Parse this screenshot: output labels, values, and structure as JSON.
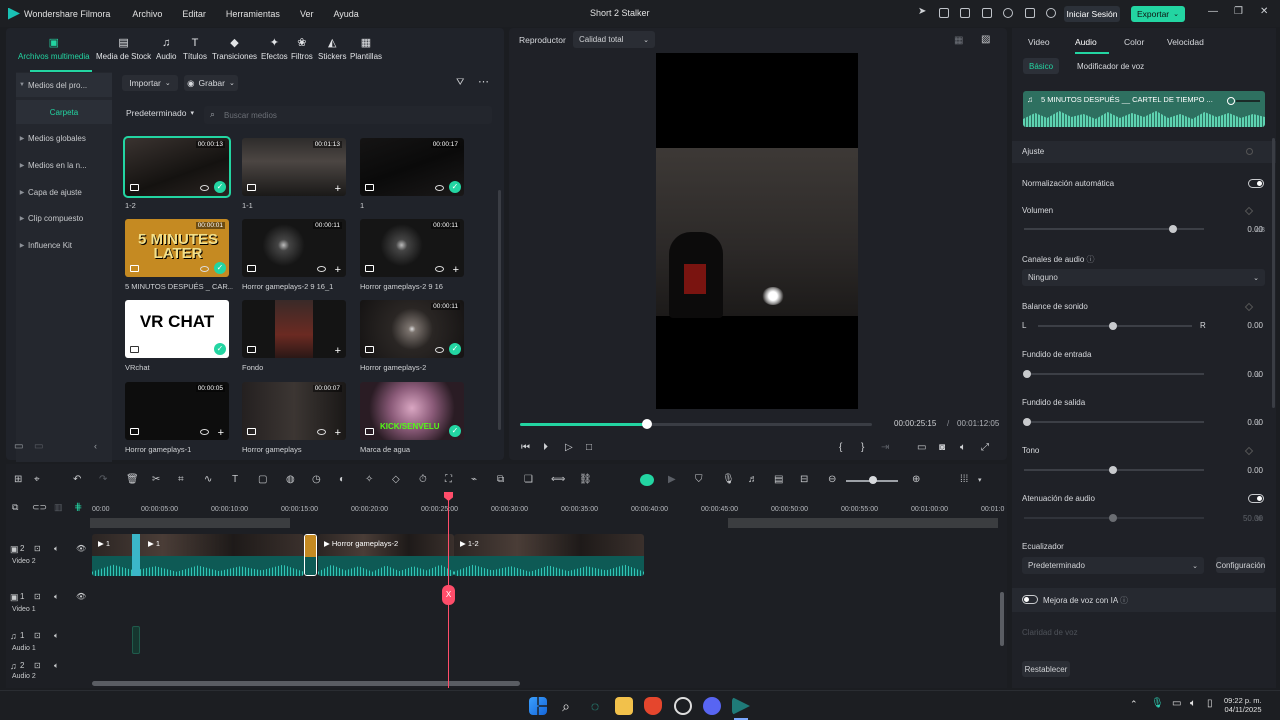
{
  "app": {
    "name": "Wondershare Filmora",
    "menu": [
      "Archivo",
      "Editar",
      "Herramientas",
      "Ver",
      "Ayuda"
    ],
    "window_title": "Short 2 Stalker",
    "login": "Iniciar Sesión",
    "export": "Exportar",
    "accent": "#23d5a2"
  },
  "media_tabs": [
    "Archivos multimedia",
    "Media de Stock",
    "Audio",
    "Títulos",
    "Transiciones",
    "Efectos",
    "Filtros",
    "Stickers",
    "Plantillas"
  ],
  "sidebar": [
    "Medios del pro...",
    "Carpeta",
    "Medios globales",
    "Medios en la n...",
    "Capa de ajuste",
    "Clip compuesto",
    "Influence Kit"
  ],
  "toolbar": {
    "import": "Importar",
    "record": "Grabar",
    "sort": "Predeterminado",
    "search_placeholder": "Buscar medios"
  },
  "media": [
    {
      "label": "1-2",
      "dur": "00:00:13"
    },
    {
      "label": "1-1",
      "dur": "00:01:13"
    },
    {
      "label": "1",
      "dur": "00:00:17"
    },
    {
      "label": "5 MINUTOS DESPUÉS _ CAR...",
      "dur": "00:00:01",
      "text": "5 MINUTES LATER"
    },
    {
      "label": "Horror gameplays-2 9 16_1",
      "dur": "00:00:11"
    },
    {
      "label": "Horror gameplays-2 9 16",
      "dur": "00:00:11"
    },
    {
      "label": "VRchat",
      "dur": "",
      "text": "VR CHAT"
    },
    {
      "label": "Fondo",
      "dur": ""
    },
    {
      "label": "Horror gameplays-2",
      "dur": "00:00:11"
    },
    {
      "label": "Horror gameplays-1",
      "dur": "00:00:05"
    },
    {
      "label": "Horror gameplays",
      "dur": "00:00:07"
    },
    {
      "label": "Marca de agua",
      "dur": "",
      "text": "KICK/SENVELU"
    }
  ],
  "player": {
    "title": "Reproductor",
    "quality": "Calidad total",
    "current": "00:00:25:15",
    "total": "00:01:12:05",
    "progress": 0.36
  },
  "props": {
    "tabs": [
      "Video",
      "Audio",
      "Color",
      "Velocidad"
    ],
    "subtabs": [
      "Básico",
      "Modificador de voz"
    ],
    "clip_title": "5 MINUTOS DESPUÉS __ CARTEL DE TIEMPO ...",
    "section": "Ajuste",
    "auto_norm": "Normalización automática",
    "volume": {
      "label": "Volumen",
      "value": "0.00",
      "unit": "dB"
    },
    "channels": {
      "label": "Canales de audio",
      "value": "Ninguno"
    },
    "balance": {
      "label": "Balance de sonido",
      "L": "L",
      "R": "R",
      "value": "0.00"
    },
    "fade_in": {
      "label": "Fundido de entrada",
      "value": "0.00",
      "unit": "s"
    },
    "fade_out": {
      "label": "Fundido  de salida",
      "value": "0.00",
      "unit": "s"
    },
    "pitch": {
      "label": "Tono",
      "value": "0.00"
    },
    "ducking": {
      "label": "Atenuación de audio",
      "value": "50.00",
      "unit": "%"
    },
    "eq": {
      "label": "Ecualizador",
      "value": "Predeterminado",
      "config": "Configuración"
    },
    "ai_voice": "Mejora de voz con IA",
    "clarity": "Claridad de voz",
    "reset": "Restablecer"
  },
  "timeline": {
    "ruler": [
      "00:00",
      "00:00:05:00",
      "00:00:10:00",
      "00:00:15:00",
      "00:00:20:00",
      "00:00:25:00",
      "00:00:30:00",
      "00:00:35:00",
      "00:00:40:00",
      "00:00:45:00",
      "00:00:50:00",
      "00:00:55:00",
      "00:01:00:00",
      "00:01:0"
    ],
    "tracks": [
      {
        "num": "2",
        "name": "Video 2"
      },
      {
        "num": "1",
        "name": "Video 1"
      },
      {
        "num": "1",
        "name": "Audio 1"
      },
      {
        "num": "2",
        "name": "Audio 2"
      }
    ],
    "clips": [
      "1",
      "1",
      "Horror gameplays-2",
      "1-2"
    ],
    "playhead_marker": "X"
  },
  "taskbar": {
    "time": "09:22 p. m.",
    "date": "04/11/2025"
  }
}
